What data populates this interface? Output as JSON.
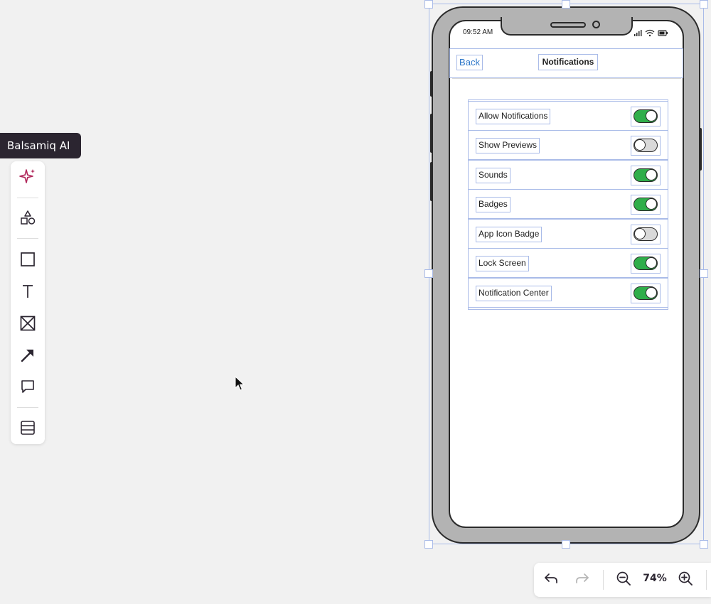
{
  "toolbar": {
    "tooltip": "Balsamiq AI",
    "tools": [
      {
        "icon": "sparkle-icon"
      },
      {
        "icon": "shapes-icon"
      },
      {
        "icon": "rectangle-icon"
      },
      {
        "icon": "text-icon"
      },
      {
        "icon": "image-placeholder-icon"
      },
      {
        "icon": "arrow-icon"
      },
      {
        "icon": "comment-icon"
      },
      {
        "icon": "table-icon"
      }
    ]
  },
  "phone": {
    "status_time": "09:52 AM",
    "nav": {
      "back_label": "Back",
      "title": "Notifications"
    },
    "settings": [
      {
        "label": "Allow Notifications",
        "enabled": true
      },
      {
        "label": "Show Previews",
        "enabled": false
      },
      {
        "label": "Sounds",
        "enabled": true
      },
      {
        "label": "Badges",
        "enabled": true
      },
      {
        "label": "App Icon Badge",
        "enabled": false
      },
      {
        "label": "Lock Screen",
        "enabled": true
      },
      {
        "label": "Notification Center",
        "enabled": true
      }
    ]
  },
  "zoom": {
    "level": "74%"
  },
  "colors": {
    "toggle_on": "#2fae4a",
    "toggle_off": "#d9d9d9",
    "selection": "#a9bbe8",
    "link": "#2a75c9",
    "ai_accent": "#b0275a"
  }
}
